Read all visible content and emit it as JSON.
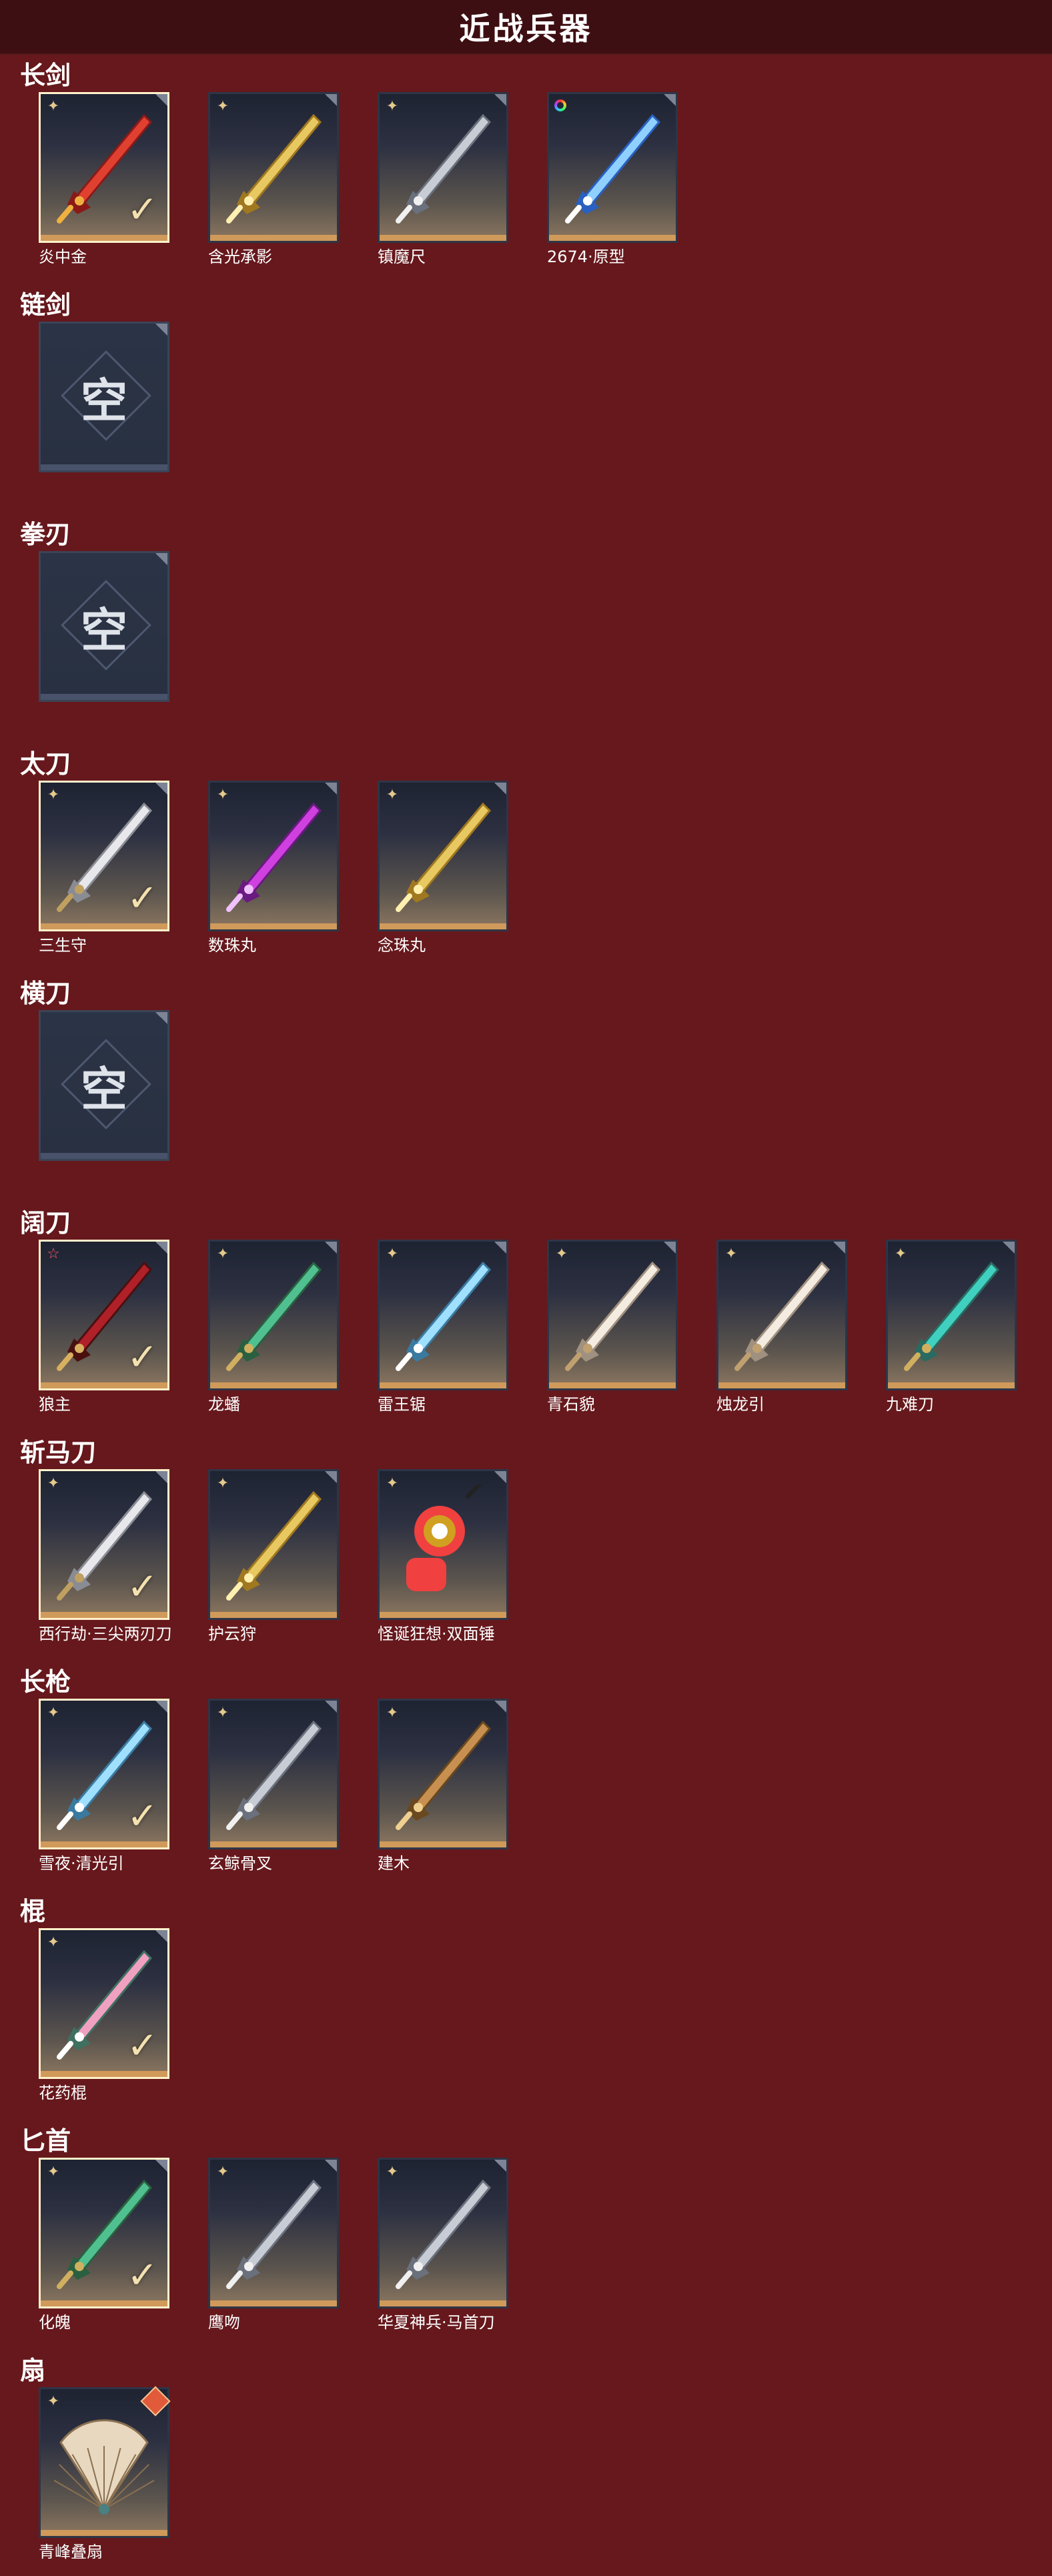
{
  "header": {
    "title": "近战兵器"
  },
  "empty_label": "空",
  "colors": {
    "background": "#66181c",
    "header": "#3e0f12",
    "card_bar": "#d09a5a",
    "selected_border": "#fff2cc"
  },
  "sections": [
    {
      "title": "长剑",
      "items": [
        {
          "name": "炎中金",
          "badge": "star4",
          "selected": true,
          "weapon": "red"
        },
        {
          "name": "含光承影",
          "badge": "star4",
          "selected": false,
          "weapon": "gold"
        },
        {
          "name": "镇魔尺",
          "badge": "star4",
          "selected": false,
          "weapon": "steel"
        },
        {
          "name": "2674·原型",
          "badge": "ring",
          "selected": false,
          "weapon": "blue"
        }
      ]
    },
    {
      "title": "链剑",
      "items": [
        {
          "empty": true
        }
      ]
    },
    {
      "title": "拳刃",
      "items": [
        {
          "empty": true
        }
      ]
    },
    {
      "title": "太刀",
      "items": [
        {
          "name": "三生守",
          "badge": "star4",
          "selected": true,
          "weapon": "silver"
        },
        {
          "name": "数珠丸",
          "badge": "star4",
          "selected": false,
          "weapon": "purple"
        },
        {
          "name": "念珠丸",
          "badge": "star4",
          "selected": false,
          "weapon": "gold"
        }
      ]
    },
    {
      "title": "横刀",
      "items": [
        {
          "empty": true
        }
      ]
    },
    {
      "title": "阔刀",
      "items": [
        {
          "name": "狼主",
          "badge": "pinkstar",
          "selected": true,
          "weapon": "darkred"
        },
        {
          "name": "龙蟠",
          "badge": "star4",
          "selected": false,
          "weapon": "green"
        },
        {
          "name": "雷王锯",
          "badge": "star4",
          "selected": false,
          "weapon": "ice"
        },
        {
          "name": "青石貌",
          "badge": "star4",
          "selected": false,
          "weapon": "white"
        },
        {
          "name": "烛龙引",
          "badge": "star4",
          "selected": false,
          "weapon": "white"
        },
        {
          "name": "九难刀",
          "badge": "star4",
          "selected": false,
          "weapon": "teal"
        }
      ]
    },
    {
      "title": "斩马刀",
      "items": [
        {
          "name": "西行劫·三尖两刃刀",
          "badge": "star4",
          "selected": true,
          "weapon": "silver"
        },
        {
          "name": "护云狩",
          "badge": "star4",
          "selected": false,
          "weapon": "gold"
        },
        {
          "name": "怪诞狂想·双面锤",
          "badge": "star4",
          "selected": false,
          "weapon": "hammer"
        }
      ]
    },
    {
      "title": "长枪",
      "items": [
        {
          "name": "雪夜·清光引",
          "badge": "star4",
          "selected": true,
          "weapon": "ice"
        },
        {
          "name": "玄鲸骨叉",
          "badge": "star4",
          "selected": false,
          "weapon": "steel"
        },
        {
          "name": "建木",
          "badge": "star4",
          "selected": false,
          "weapon": "bronze"
        }
      ]
    },
    {
      "title": "棍",
      "items": [
        {
          "name": "花药棍",
          "badge": "star4",
          "selected": true,
          "weapon": "pink"
        }
      ]
    },
    {
      "title": "匕首",
      "items": [
        {
          "name": "化魄",
          "badge": "star4",
          "selected": true,
          "weapon": "green"
        },
        {
          "name": "鹰吻",
          "badge": "star4",
          "selected": false,
          "weapon": "steel"
        },
        {
          "name": "华夏神兵·马首刀",
          "badge": "star4",
          "selected": false,
          "weapon": "steel"
        }
      ]
    },
    {
      "title": "扇",
      "items": [
        {
          "name": "青峰叠扇",
          "badge": "star4",
          "selected": false,
          "weapon": "fan",
          "corner_mark": true
        }
      ]
    }
  ]
}
